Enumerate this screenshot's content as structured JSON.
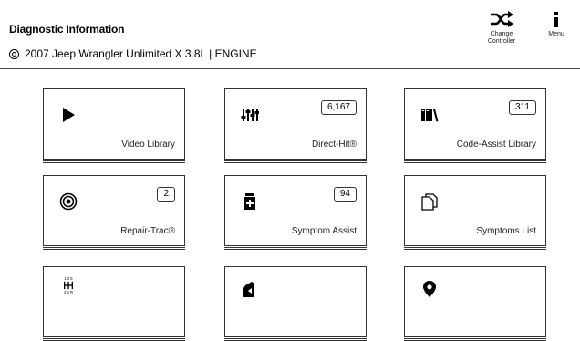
{
  "header": {
    "title": "Diagnostic Information",
    "vehicle": "2007 Jeep Wrangler Unlimited X 3.8L | ENGINE",
    "change_controller_label": "Change Controller",
    "menu_label": "Menu"
  },
  "tiles": [
    {
      "label": "Video Library",
      "count": "",
      "icon": "play-icon"
    },
    {
      "label": "Direct-Hit®",
      "count": "6,167",
      "icon": "sliders-icon"
    },
    {
      "label": "Code-Assist Library",
      "count": "311",
      "icon": "books-icon"
    },
    {
      "label": "Repair-Trac®",
      "count": "2",
      "icon": "target-icon"
    },
    {
      "label": "Symptom Assist",
      "count": "94",
      "icon": "medicine-bottle-icon"
    },
    {
      "label": "Symptoms List",
      "count": "",
      "icon": "documents-icon"
    },
    {
      "label": "",
      "count": "",
      "icon": "gear-shift-icon",
      "icon_text": "1 3 5\n2 4 R"
    },
    {
      "label": "",
      "count": "",
      "icon": "oil-can-icon"
    },
    {
      "label": "",
      "count": "",
      "icon": "location-pin-icon"
    }
  ]
}
